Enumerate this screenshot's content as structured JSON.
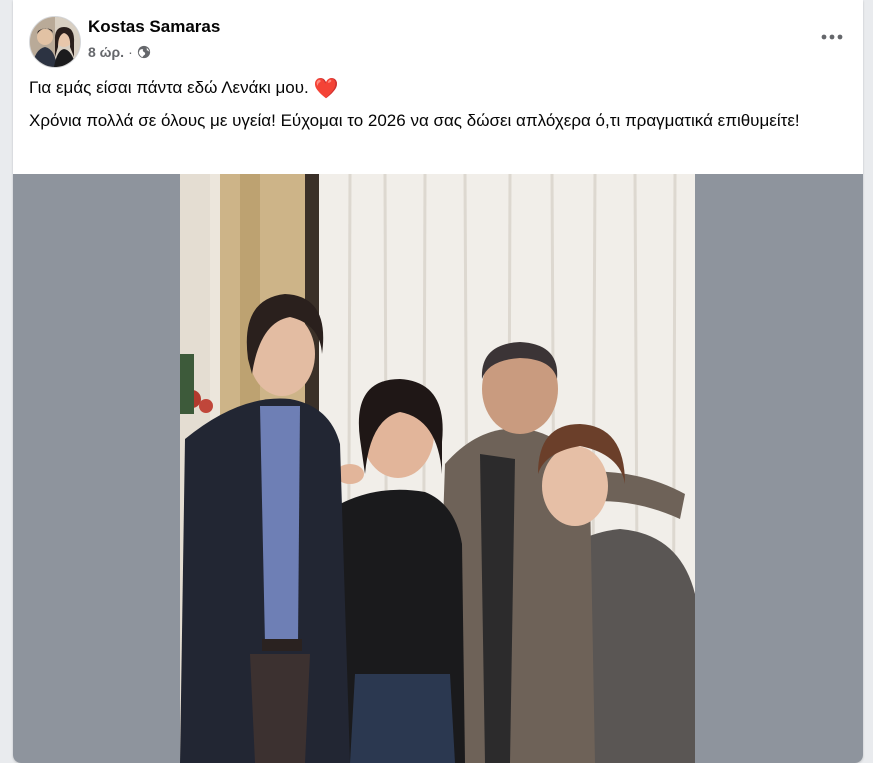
{
  "post": {
    "author": "Kostas Samaras",
    "time": "8 ώρ.",
    "separator": "·",
    "privacy_icon": "globe-icon",
    "more_icon": "more-options-icon",
    "text_line1": "Για εμάς είσαι πάντα εδώ Λενάκι μου.",
    "emoji": "❤️",
    "text_line2": "Χρόνια πολλά σε όλους με υγεία! Εύχομαι το 2026 να σας δώσει απλόχερα ό,τι πραγματικά επιθυμείτε!"
  },
  "colors": {
    "background": "#e9ebee",
    "card": "#ffffff",
    "media_backdrop": "#8e949d",
    "secondary_text": "#65676b",
    "heart": "#e0243a"
  }
}
